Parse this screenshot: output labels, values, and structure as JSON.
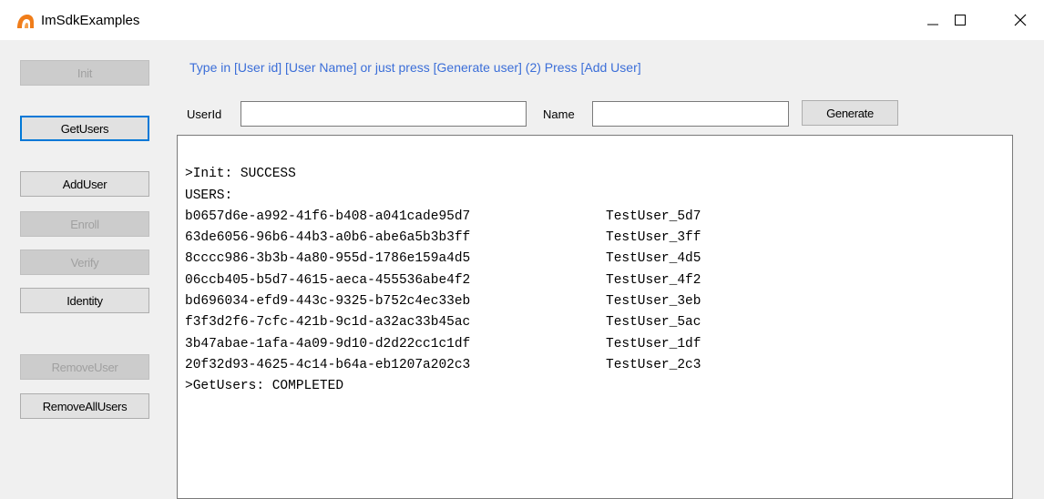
{
  "window": {
    "title": "ImSdkExamples",
    "icon": "app-logo-icon",
    "controls": [
      "minimize-icon",
      "maximize-icon",
      "close-icon"
    ]
  },
  "sidebar": {
    "init_label": "Init",
    "getusers_label": "GetUsers",
    "adduser_label": "AddUser",
    "enroll_label": "Enroll",
    "verify_label": "Verify",
    "identity_label": "Identity",
    "removeuser_label": "RemoveUser",
    "removeallusers_label": "RemoveAllUsers"
  },
  "form": {
    "instruction": "Type in [User id] [User Name] or just press [Generate user] (2) Press [Add User]",
    "userid_label": "UserId",
    "userid_value": "",
    "name_label": "Name",
    "name_value": "",
    "generate_label": "Generate"
  },
  "output": {
    "init_line": ">Init: SUCCESS",
    "users_header": "USERS:",
    "users": [
      {
        "id": "b0657d6e-a992-41f6-b408-a041cade95d7",
        "name": "TestUser_5d7"
      },
      {
        "id": "63de6056-96b6-44b3-a0b6-abe6a5b3b3ff",
        "name": "TestUser_3ff"
      },
      {
        "id": "8cccc986-3b3b-4a80-955d-1786e159a4d5",
        "name": "TestUser_4d5"
      },
      {
        "id": "06ccb405-b5d7-4615-aeca-455536abe4f2",
        "name": "TestUser_4f2"
      },
      {
        "id": "bd696034-efd9-443c-9325-b752c4ec33eb",
        "name": "TestUser_3eb"
      },
      {
        "id": "f3f3d2f6-7cfc-421b-9c1d-a32ac33b45ac",
        "name": "TestUser_5ac"
      },
      {
        "id": "3b47abae-1afa-4a09-9d10-d2d22cc1c1df",
        "name": "TestUser_1df"
      },
      {
        "id": "20f32d93-4625-4c14-b64a-eb1207a202c3",
        "name": "TestUser_2c3"
      }
    ],
    "completed_line": ">GetUsers: COMPLETED"
  },
  "colors": {
    "instruction": "#3b6ed8",
    "focus_border": "#0078d7",
    "app_icon": "#f07d1a"
  }
}
